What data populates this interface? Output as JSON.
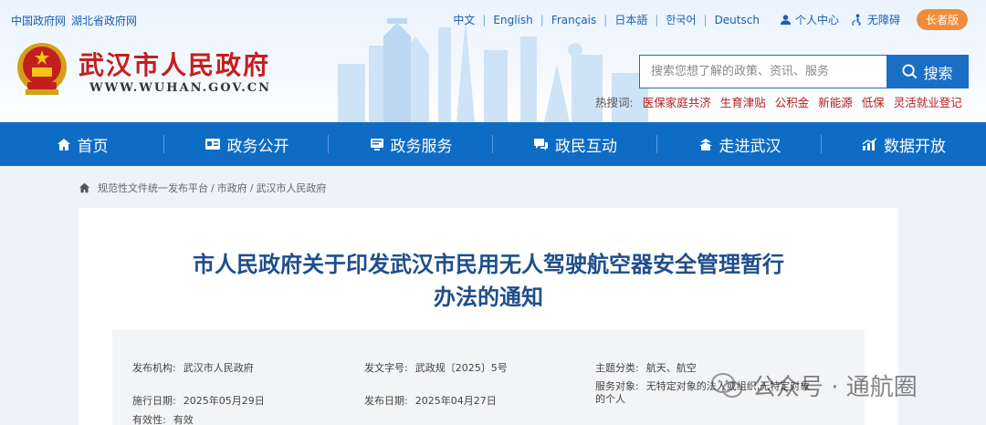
{
  "header": {
    "links": [
      "中国政府网",
      "湖北省政府网"
    ],
    "languages": [
      "中文",
      "English",
      "Français",
      "日本語",
      "한국어",
      "Deutsch"
    ],
    "personal_center": "个人中心",
    "accessibility": "无障碍",
    "elder_mode": "长者版",
    "site_name": "武汉市人民政府",
    "site_url": "WWW.WUHAN.GOV.CN"
  },
  "search": {
    "placeholder": "搜索您想了解的政策、资讯、服务",
    "button_label": "搜索",
    "hot_label": "热搜词:",
    "hot_words": [
      "医保家庭共济",
      "生育津贴",
      "公积金",
      "新能源",
      "低保",
      "灵活就业登记"
    ]
  },
  "nav": {
    "items": [
      {
        "label": "首页",
        "icon": "home-icon"
      },
      {
        "label": "政务公开",
        "icon": "id-card-icon"
      },
      {
        "label": "政务服务",
        "icon": "monitor-icon"
      },
      {
        "label": "政民互动",
        "icon": "chat-icon"
      },
      {
        "label": "走进武汉",
        "icon": "pavilion-icon"
      },
      {
        "label": "数据开放",
        "icon": "chart-icon"
      }
    ]
  },
  "breadcrumb": [
    "规范性文件统一发布平台",
    "市政府",
    "武汉市人民政府"
  ],
  "article": {
    "title_line1": "市人民政府关于印发武汉市民用无人驾驶航空器安全管理暂行",
    "title_line2": "办法的通知",
    "meta": {
      "issuer_label": "发布机构:",
      "issuer": "武汉市人民政府",
      "doc_no_label": "发文字号:",
      "doc_no": "武政规〔2025〕5号",
      "topic_label": "主题分类:",
      "topic": "航天、航空",
      "effective_date_label": "施行日期:",
      "effective_date": "2025年05月29日",
      "publish_date_label": "发布日期:",
      "publish_date": "2025年04月27日",
      "audience_label": "服务对象:",
      "audience": "无特定对象的法人或组织,无特定对象的个人",
      "validity_label": "有效性:",
      "validity": "有效"
    }
  },
  "watermark": {
    "text": "公众号 · 通航圈"
  },
  "colors": {
    "primary": "#0f6cc4",
    "site_name": "#c41f1f",
    "title": "#1f4e8c",
    "elder": "#f08c3a"
  }
}
